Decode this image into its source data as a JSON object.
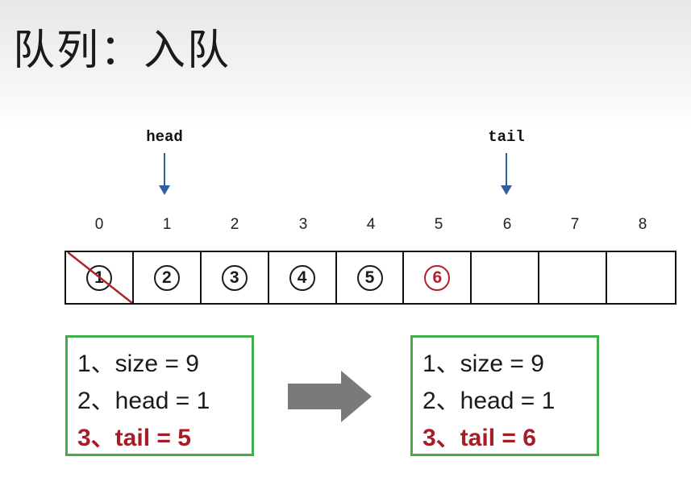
{
  "title": "队列：入队",
  "pointers": {
    "head": {
      "label": "head",
      "index": 1
    },
    "tail": {
      "label": "tail",
      "index": 6
    }
  },
  "indices": [
    "0",
    "1",
    "2",
    "3",
    "4",
    "5",
    "6",
    "7",
    "8"
  ],
  "cells": [
    {
      "label": "1",
      "state": "removed"
    },
    {
      "label": "2",
      "state": "normal"
    },
    {
      "label": "3",
      "state": "normal"
    },
    {
      "label": "4",
      "state": "normal"
    },
    {
      "label": "5",
      "state": "normal"
    },
    {
      "label": "6",
      "state": "new"
    },
    {
      "label": "",
      "state": "empty"
    },
    {
      "label": "",
      "state": "empty"
    },
    {
      "label": "",
      "state": "empty"
    }
  ],
  "before_box": {
    "lines": [
      {
        "text": "1、size = 9",
        "highlight": false
      },
      {
        "text": "2、head = 1",
        "highlight": false
      },
      {
        "text": "3、tail = 5",
        "highlight": true
      }
    ]
  },
  "after_box": {
    "lines": [
      {
        "text": "1、size = 9",
        "highlight": false
      },
      {
        "text": "2、head = 1",
        "highlight": false
      },
      {
        "text": "3、tail = 6",
        "highlight": true
      }
    ]
  },
  "colors": {
    "box_border": "#3fae49",
    "highlight_text": "#a61d27",
    "new_element": "#b0202a",
    "pointer_arrow": "#2f5f9e",
    "transition_arrow": "#7a7a7a"
  }
}
